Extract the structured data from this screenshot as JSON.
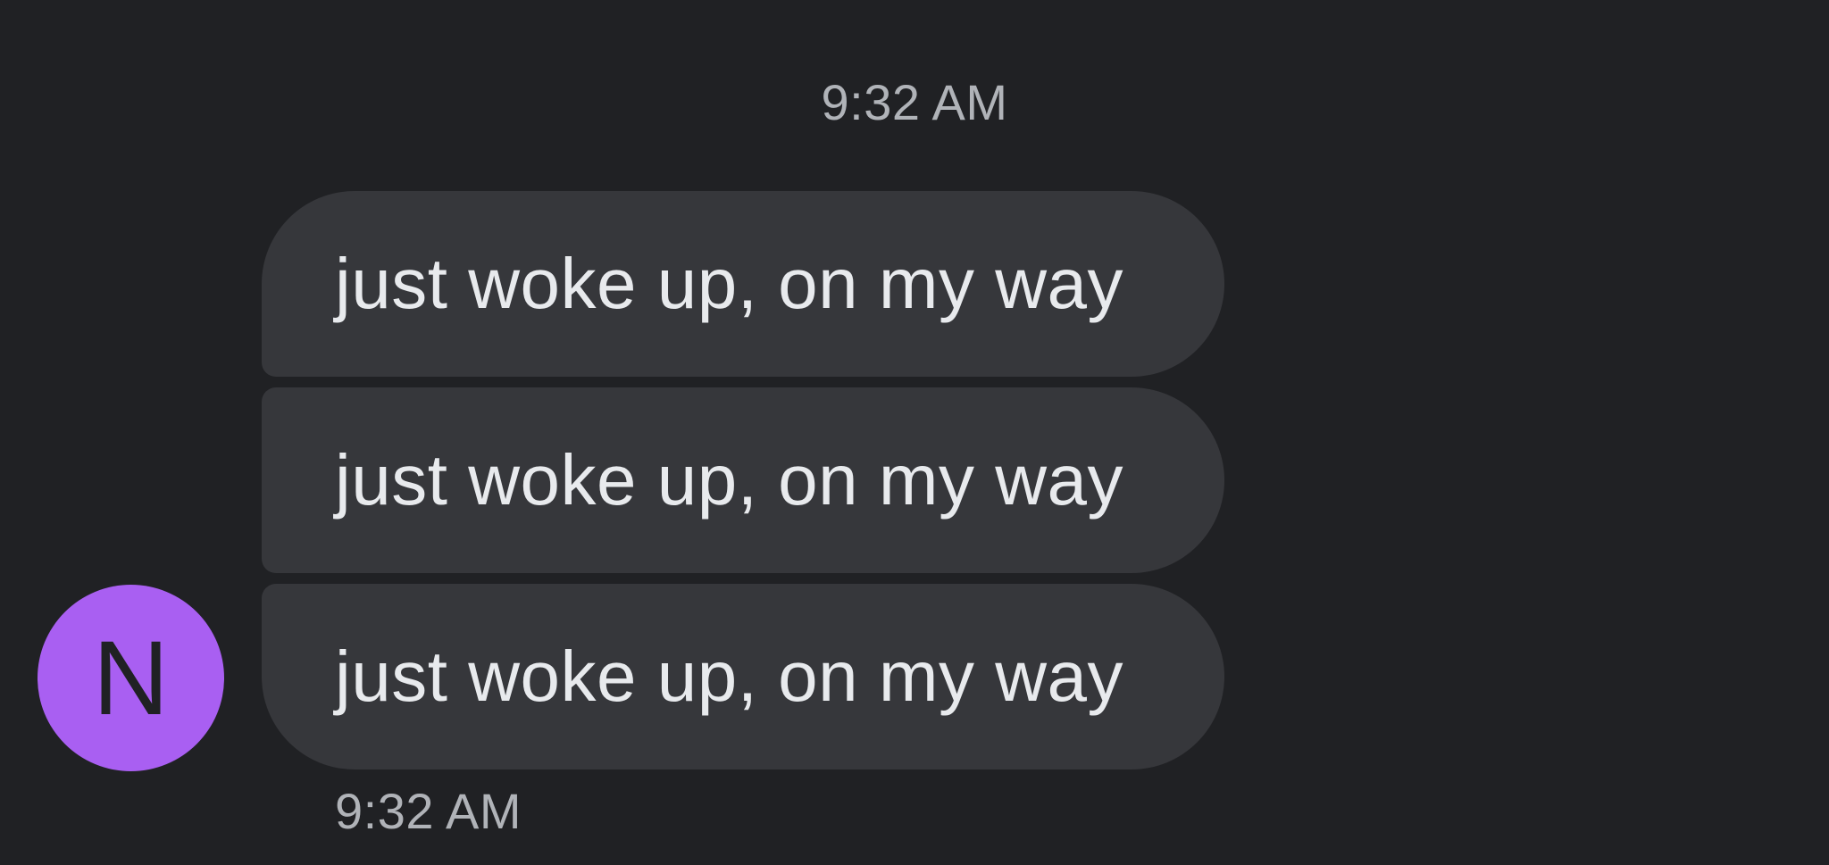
{
  "conversation": {
    "header_timestamp": "9:32 AM",
    "sender": {
      "initial": "N",
      "avatar_color": "#a95ff2"
    },
    "messages": [
      {
        "text": "just woke up, on my way"
      },
      {
        "text": "just woke up, on my way"
      },
      {
        "text": "just woke up, on my way"
      }
    ],
    "footer_timestamp": "9:32 AM"
  },
  "colors": {
    "background": "#202124",
    "bubble": "#36373b",
    "message_text": "#e8eaed",
    "timestamp_text": "#b0b3b8"
  }
}
